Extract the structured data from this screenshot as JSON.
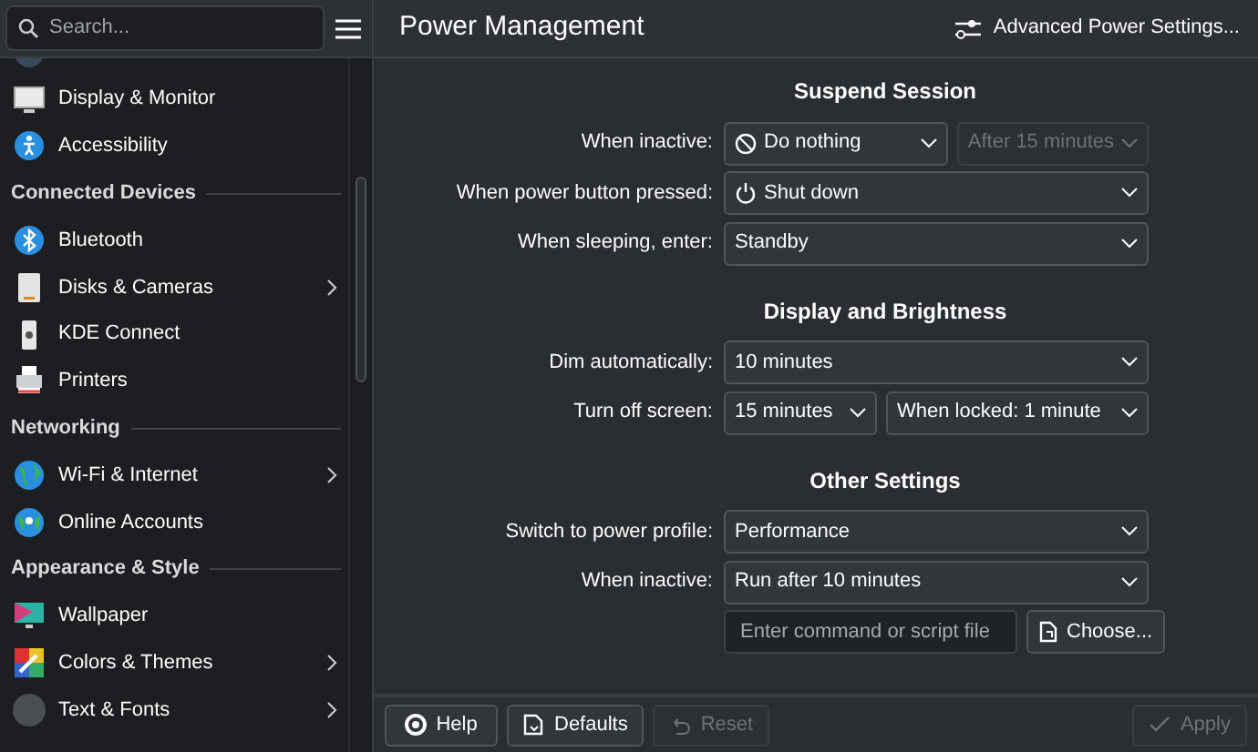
{
  "sidebar": {
    "search": {
      "placeholder": "Search..."
    },
    "items": [
      {
        "kind": "item",
        "label": "Display & Monitor",
        "has_children": false
      },
      {
        "kind": "item",
        "label": "Accessibility",
        "has_children": false
      },
      {
        "kind": "header",
        "label": "Connected Devices"
      },
      {
        "kind": "item",
        "label": "Bluetooth",
        "has_children": false
      },
      {
        "kind": "item",
        "label": "Disks & Cameras",
        "has_children": true
      },
      {
        "kind": "item",
        "label": "KDE Connect",
        "has_children": false
      },
      {
        "kind": "item",
        "label": "Printers",
        "has_children": false
      },
      {
        "kind": "header",
        "label": "Networking"
      },
      {
        "kind": "item",
        "label": "Wi-Fi & Internet",
        "has_children": true
      },
      {
        "kind": "item",
        "label": "Online Accounts",
        "has_children": false
      },
      {
        "kind": "header",
        "label": "Appearance & Style"
      },
      {
        "kind": "item",
        "label": "Wallpaper",
        "has_children": false
      },
      {
        "kind": "item",
        "label": "Colors & Themes",
        "has_children": true
      },
      {
        "kind": "item",
        "label": "Text & Fonts",
        "has_children": true
      }
    ]
  },
  "page": {
    "title": "Power Management",
    "advanced_button": "Advanced Power Settings...",
    "sections": [
      {
        "title": "Suspend Session",
        "rows": [
          {
            "label": "When inactive:",
            "controls": [
              {
                "kind": "combo",
                "value": "Do nothing",
                "disabled": false,
                "has_icon": true
              },
              {
                "kind": "combo",
                "value": "After 15 minutes",
                "disabled": true,
                "has_icon": false
              }
            ]
          },
          {
            "label": "When power button pressed:",
            "controls": [
              {
                "kind": "combo",
                "value": "Shut down",
                "disabled": false,
                "has_icon": true
              }
            ]
          },
          {
            "label": "When sleeping, enter:",
            "controls": [
              {
                "kind": "combo",
                "value": "Standby",
                "disabled": false,
                "has_icon": false
              }
            ]
          }
        ]
      },
      {
        "title": "Display and Brightness",
        "rows": [
          {
            "label": "Dim automatically:",
            "controls": [
              {
                "kind": "combo",
                "value": "10 minutes",
                "disabled": false,
                "has_icon": false
              }
            ]
          },
          {
            "label": "Turn off screen:",
            "controls": [
              {
                "kind": "combo",
                "value": "15 minutes",
                "disabled": false,
                "has_icon": false
              },
              {
                "kind": "combo",
                "value": "When locked: 1 minute",
                "disabled": false,
                "has_icon": false
              }
            ]
          }
        ]
      },
      {
        "title": "Other Settings",
        "rows": [
          {
            "label": "Switch to power profile:",
            "controls": [
              {
                "kind": "combo",
                "value": "Performance",
                "disabled": false,
                "has_icon": false
              }
            ]
          },
          {
            "label": "When inactive:",
            "controls": [
              {
                "kind": "combo",
                "value": "Run after 10 minutes",
                "disabled": false,
                "has_icon": false
              }
            ]
          },
          {
            "controls": [
              {
                "kind": "field",
                "placeholder": "Enter command or script file"
              },
              {
                "kind": "button",
                "value": "Choose...",
                "disabled": false,
                "has_icon": true
              }
            ]
          }
        ]
      }
    ]
  },
  "footer": {
    "buttons": [
      {
        "label": "Help",
        "disabled": false
      },
      {
        "label": "Defaults",
        "disabled": false
      },
      {
        "label": "Reset",
        "disabled": true
      },
      {
        "label": "Apply",
        "disabled": true
      }
    ]
  }
}
